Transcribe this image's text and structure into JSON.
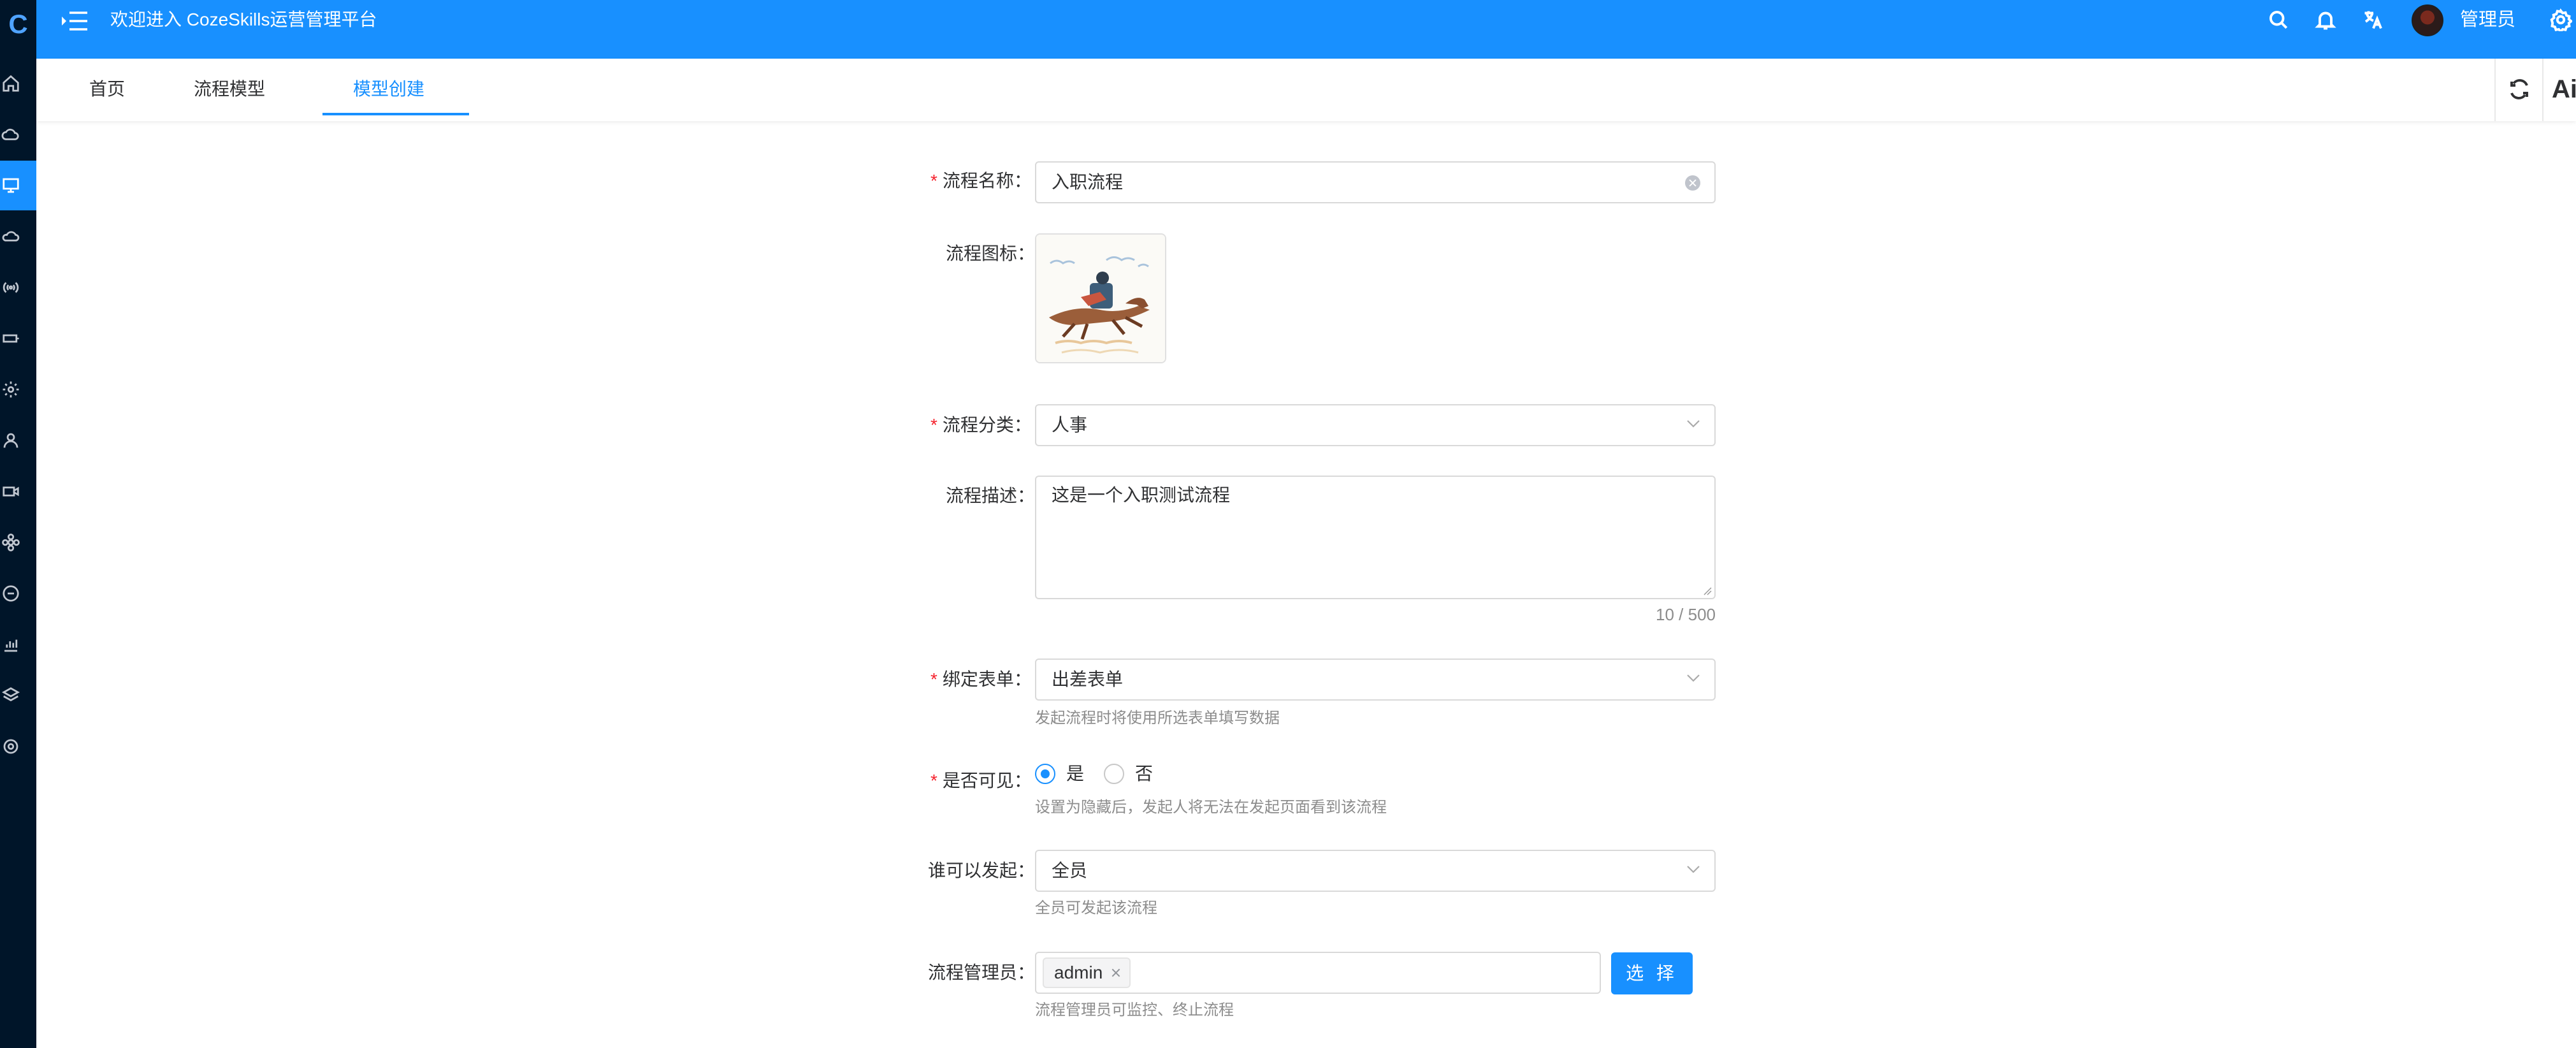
{
  "header": {
    "title": "欢迎进入 CozeSkills运营管理平台",
    "user_name": "管理员",
    "icons": [
      "menu-fold-icon",
      "search-icon",
      "bell-icon",
      "translate-icon",
      "settings-icon"
    ]
  },
  "sidebar": {
    "icons": [
      "logo-icon",
      "home-icon",
      "cloud-icon",
      "monitor-icon",
      "cloud-outline-icon",
      "signal-icon",
      "battery-icon",
      "gear-icon",
      "user-icon",
      "camera-icon",
      "flower-icon",
      "dashboard-icon",
      "bar-chart-icon",
      "layers-icon",
      "settings-icon"
    ],
    "active_index": 2
  },
  "tabs": {
    "items": [
      {
        "label": "首页"
      },
      {
        "label": "流程模型"
      },
      {
        "label": "模型创建"
      }
    ],
    "active_index": 2,
    "right_label": "Ai"
  },
  "form": {
    "name": {
      "label": "流程名称",
      "value": "入职流程",
      "required": true
    },
    "icon": {
      "label": "流程图标"
    },
    "category": {
      "label": "流程分类",
      "value": "人事",
      "required": true
    },
    "description": {
      "label": "流程描述",
      "value": "这是一个入职测试流程",
      "counter": "10 / 500"
    },
    "bind_form": {
      "label": "绑定表单",
      "value": "出差表单",
      "required": true,
      "hint": "发起流程时将使用所选表单填写数据"
    },
    "visible": {
      "label": "是否可见",
      "required": true,
      "options": [
        "是",
        "否"
      ],
      "selected": "是",
      "hint": "设置为隐藏后，发起人将无法在发起页面看到该流程"
    },
    "initiator": {
      "label": "谁可以发起",
      "value": "全员",
      "hint": "全员可发起该流程"
    },
    "admins": {
      "label": "流程管理员",
      "tags": [
        "admin"
      ],
      "select_button": "选 择",
      "hint": "流程管理员可监控、终止流程"
    }
  },
  "colors": {
    "primary": "#1890ff",
    "sidebar_bg": "#001529",
    "required": "#f5222d"
  }
}
